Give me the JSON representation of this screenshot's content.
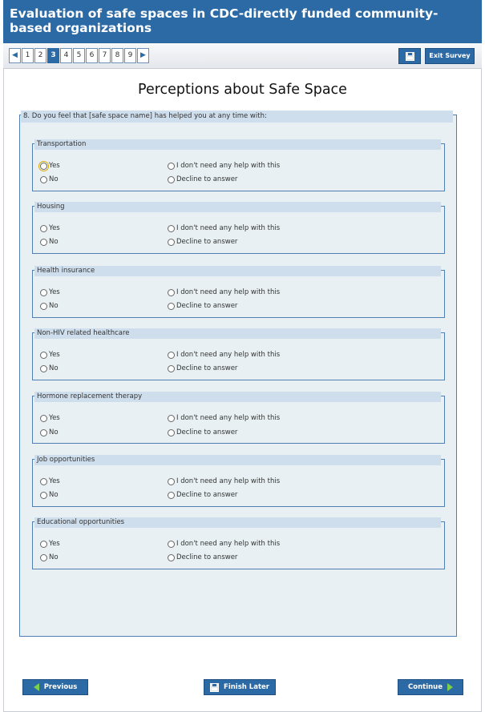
{
  "title": "Evaluation of safe spaces in CDC-directly funded community-based organizations",
  "pager": [
    "1",
    "2",
    "3",
    "4",
    "5",
    "6",
    "7",
    "8",
    "9"
  ],
  "current_page": "3",
  "exit_label": "Exit Survey",
  "page_heading": "Perceptions about Safe Space",
  "question": "8. Do you feel that [safe space name] has helped you at any time with:",
  "options": {
    "yes": "Yes",
    "no": "No",
    "no_help": "I don't need any help with this",
    "decline": "Decline to answer"
  },
  "groups": [
    {
      "label": "Transportation"
    },
    {
      "label": "Housing"
    },
    {
      "label": "Health insurance"
    },
    {
      "label": "Non-HIV related healthcare"
    },
    {
      "label": "Hormone replacement therapy"
    },
    {
      "label": "Job opportunities"
    },
    {
      "label": "Educational opportunities"
    }
  ],
  "buttons": {
    "previous": "Previous",
    "finish_later": "Finish Later",
    "continue": "Continue"
  },
  "colors": {
    "primary": "#2c6aa6",
    "panel": "#e8f0f3",
    "label_bg": "#cfdeec",
    "arrow": "#7cd04a"
  }
}
